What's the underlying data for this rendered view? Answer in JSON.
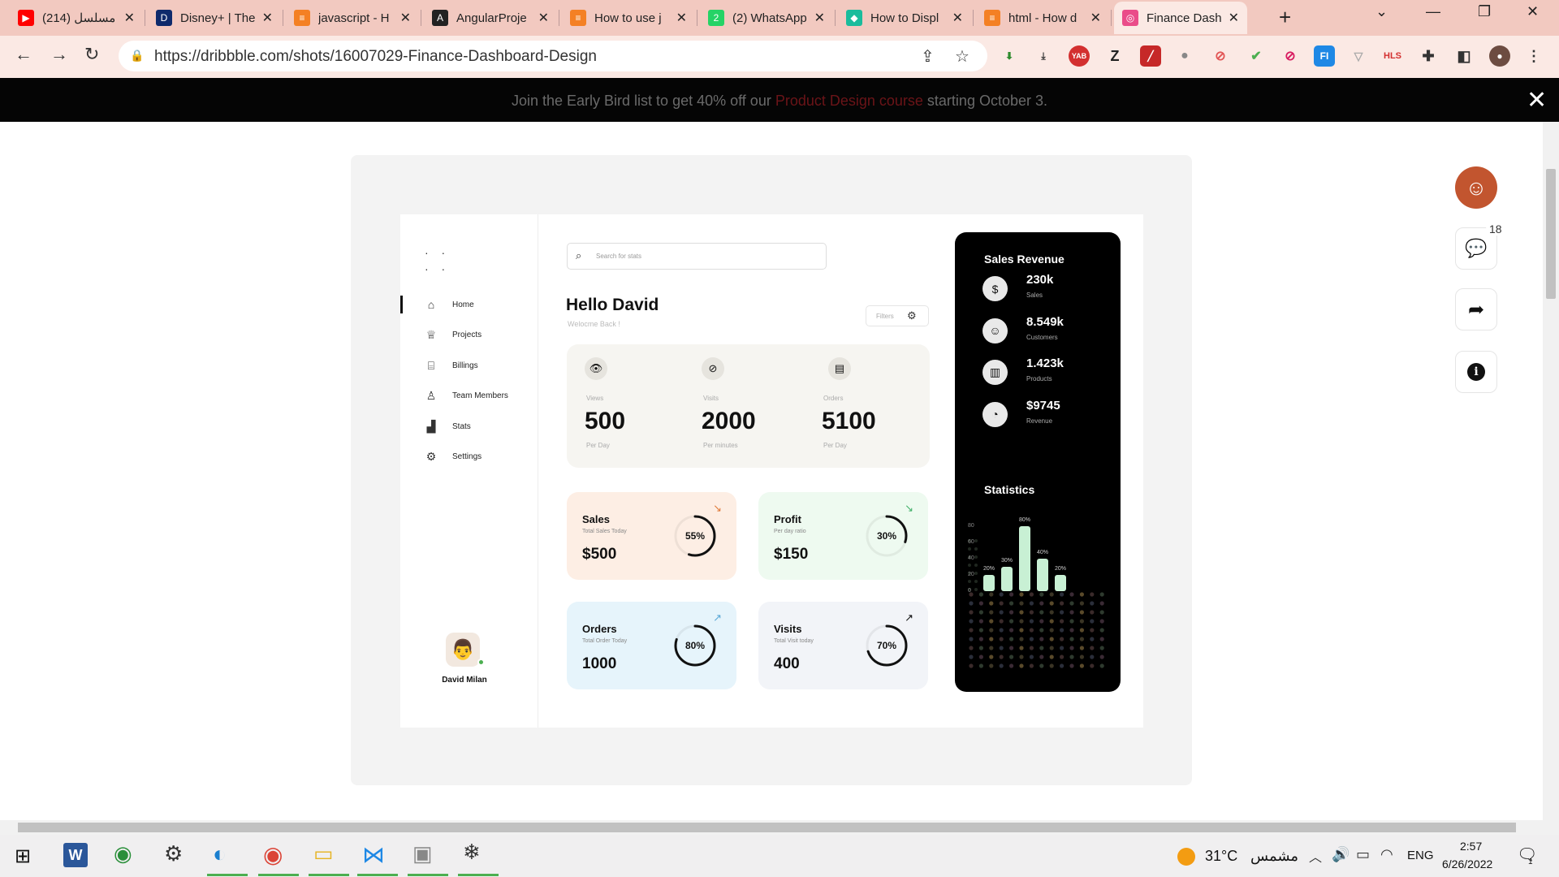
{
  "browser": {
    "tabs": [
      {
        "title": "(214) مسلسل",
        "favicon": "youtube-icon",
        "color": "#ff0000",
        "glyph": "▶"
      },
      {
        "title": "Disney+ | The",
        "favicon": "disney-icon",
        "color": "#0e2a6c",
        "glyph": "D"
      },
      {
        "title": "javascript - H",
        "favicon": "stackoverflow-icon",
        "color": "#f48024",
        "glyph": "≡"
      },
      {
        "title": "AngularProje",
        "favicon": "angular-icon",
        "color": "#222222",
        "glyph": "A"
      },
      {
        "title": "How to use j",
        "favicon": "stackoverflow-icon",
        "color": "#f48024",
        "glyph": "≡"
      },
      {
        "title": "(2) WhatsApp",
        "favicon": "whatsapp-icon",
        "color": "#25d366",
        "glyph": "2"
      },
      {
        "title": "How to Displ",
        "favicon": "site-icon",
        "color": "#1abc9c",
        "glyph": "◆"
      },
      {
        "title": "html - How d",
        "favicon": "stackoverflow-icon",
        "color": "#f48024",
        "glyph": "≡"
      },
      {
        "title": "Finance Dash",
        "favicon": "dribbble-icon",
        "color": "#ea4c89",
        "glyph": "◎"
      }
    ],
    "url": "https://dribbble.com/shots/16007029-Finance-Dashboard-Design"
  },
  "promo": {
    "before": "Join the Early Bird list to get 40% off our ",
    "link": "Product Design course",
    "after": " starting October 3."
  },
  "engagement": {
    "comment_count": "18"
  },
  "dashboard": {
    "nav": [
      "Home",
      "Projects",
      "Billings",
      "Team Members",
      "Stats",
      "Settings"
    ],
    "user": "David Milan",
    "search_placeholder": "Search for stats",
    "greeting": "Hello David",
    "welcome": "Welocme Back !",
    "filters": "Filters",
    "stats": [
      {
        "label": "Views",
        "value": "500",
        "sub": "Per Day",
        "icon": "eye-icon"
      },
      {
        "label": "Visits",
        "value": "2000",
        "sub": "Per minutes",
        "icon": "compass-icon"
      },
      {
        "label": "Orders",
        "value": "5100",
        "sub": "Per Day",
        "icon": "store-icon"
      }
    ],
    "kpis": [
      {
        "title": "Sales",
        "sub": "Total Sales Today",
        "value": "$500",
        "percent_label": "55%",
        "percent": 55,
        "bg": "#fdeee4",
        "arrow": "↘",
        "arrow_color": "#e07a3a"
      },
      {
        "title": "Profit",
        "sub": "Per day ratio",
        "value": "$150",
        "percent_label": "30%",
        "percent": 30,
        "bg": "#eefaf0",
        "arrow": "↘",
        "arrow_color": "#43b06a"
      },
      {
        "title": "Orders",
        "sub": "Total Order Today",
        "value": "1000",
        "percent_label": "80%",
        "percent": 80,
        "bg": "#e6f4fb",
        "arrow": "↗",
        "arrow_color": "#5aa8d6"
      },
      {
        "title": "Visits",
        "sub": "Total Visit today",
        "value": "400",
        "percent_label": "70%",
        "percent": 70,
        "bg": "#f2f4f8",
        "arrow": "↗",
        "arrow_color": "#111111"
      }
    ],
    "revenue": {
      "title": "Sales Revenue",
      "items": [
        {
          "value": "230k",
          "label": "Sales",
          "icon": "dollar-icon"
        },
        {
          "value": "8.549k",
          "label": "Customers",
          "icon": "user-circle-icon"
        },
        {
          "value": "1.423k",
          "label": "Products",
          "icon": "box-icon"
        },
        {
          "value": "$9745",
          "label": "Revenue",
          "icon": "pie-icon"
        }
      ]
    },
    "statistics_title": "Statistics"
  },
  "chart_data": {
    "type": "bar",
    "title": "Statistics",
    "y_ticks": [
      "80",
      "60",
      "40",
      "20",
      "0"
    ],
    "ylim": [
      0,
      80
    ],
    "values": [
      20,
      30,
      80,
      40,
      20
    ],
    "value_labels": [
      "20%",
      "30%",
      "80%",
      "40%",
      "20%"
    ]
  },
  "taskbar": {
    "temperature": "31°C",
    "weather": "مشمس",
    "language": "ENG",
    "time": "2:57",
    "date": "6/26/2022",
    "notifications": "1"
  }
}
